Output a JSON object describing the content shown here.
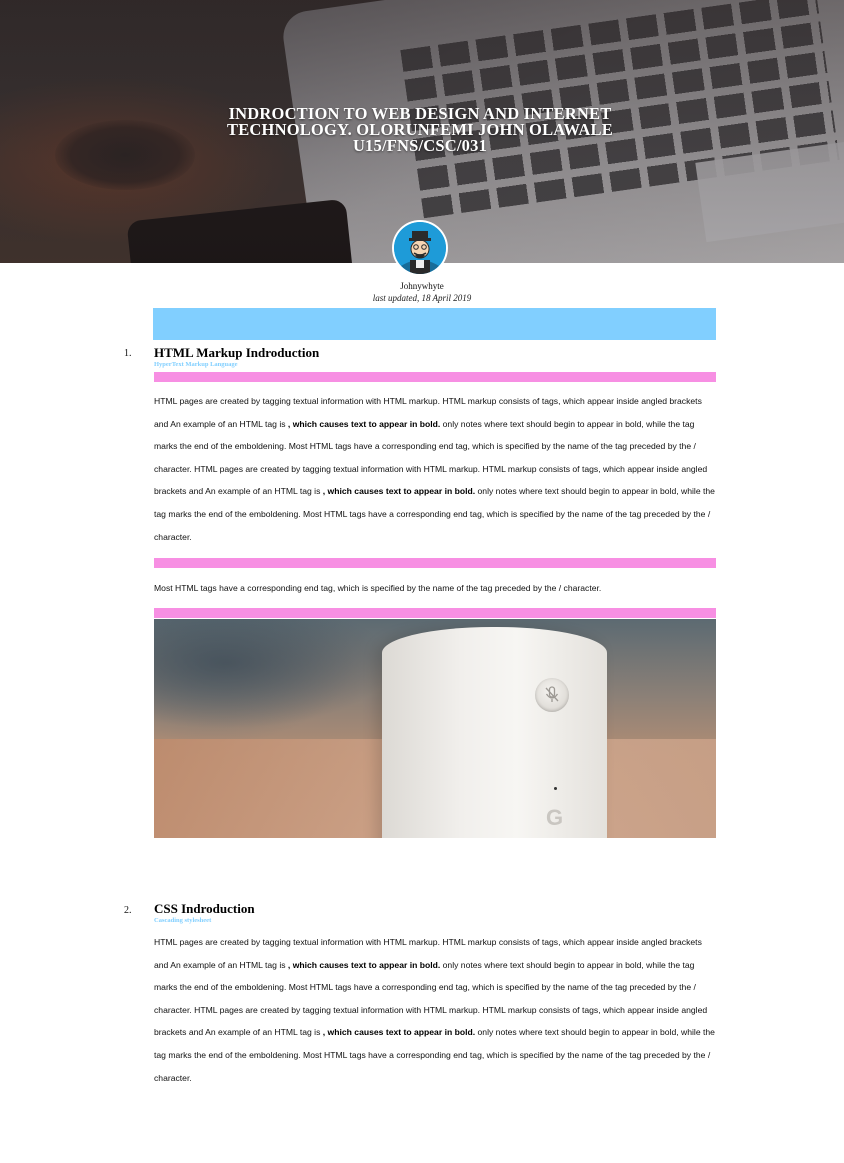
{
  "header": {
    "title_line1": "INDROCTION TO WEB DESIGN AND INTERNET",
    "title_line2": "TECHNOLOGY. OLORUNFEMI JOHN OLAWALE",
    "title_line3": "U15/FNS/CSC/031"
  },
  "author": {
    "name": "Johnywhyte",
    "last_updated": "last updated, 18 April 2019"
  },
  "sections": [
    {
      "number": "1.",
      "title": "HTML Markup Indroduction",
      "subtitle": "HyperText Markup Language",
      "p_a": "HTML pages are created by tagging textual information with HTML markup. HTML markup consists of tags, which appear inside angled brackets and An example of an HTML tag is",
      "p_bold1": ", which causes text to appear in bold.",
      "p_b": "only notes where text should begin to appear in bold, while the tag marks the end of the emboldening. Most HTML tags have a corresponding end tag, which is specified by the name of the tag preceded by the / character. HTML pages are created by tagging textual information with HTML markup. HTML markup consists of tags, which appear inside angled brackets and An example of an HTML tag is",
      "p_bold2": ", which causes text to appear in bold.",
      "p_c": "only notes where text should begin to appear in bold, while the tag marks the end of the emboldening. Most HTML tags have a corresponding end tag, which is specified by the name of the tag preceded by the / character.",
      "note": "Most HTML tags have a corresponding end tag, which is specified by the name of the tag preceded by the / character.",
      "photo_logo": "G"
    },
    {
      "number": "2.",
      "title": "CSS Indroduction",
      "subtitle": "Cascading stylesheet",
      "p_a": "HTML pages are created by tagging textual information with HTML markup. HTML markup consists of tags, which appear inside angled brackets and An example of an HTML tag is",
      "p_bold1": ", which causes text to appear in bold.",
      "p_b": "only notes where text should begin to appear in bold, while the tag marks the end of the emboldening. Most HTML tags have a corresponding end tag, which is specified by the name of the tag preceded by the / character. HTML pages are created by tagging textual information with HTML markup. HTML markup consists of tags, which appear inside angled brackets and An example of an HTML tag is",
      "p_bold2": ", which causes text to appear in bold.",
      "p_c": "only notes where text should begin to appear in bold, while the tag marks the end of the emboldening. Most HTML tags have a corresponding end tag, which is specified by the name of the tag preceded by the / character."
    }
  ],
  "colors": {
    "accent_blue": "#81cfff",
    "accent_pink": "#f78fe3",
    "avatar_bg": "#1e9bd8"
  },
  "icons": {
    "avatar": "cartoon-man-avatar-icon",
    "mic": "mic-mute-icon"
  }
}
